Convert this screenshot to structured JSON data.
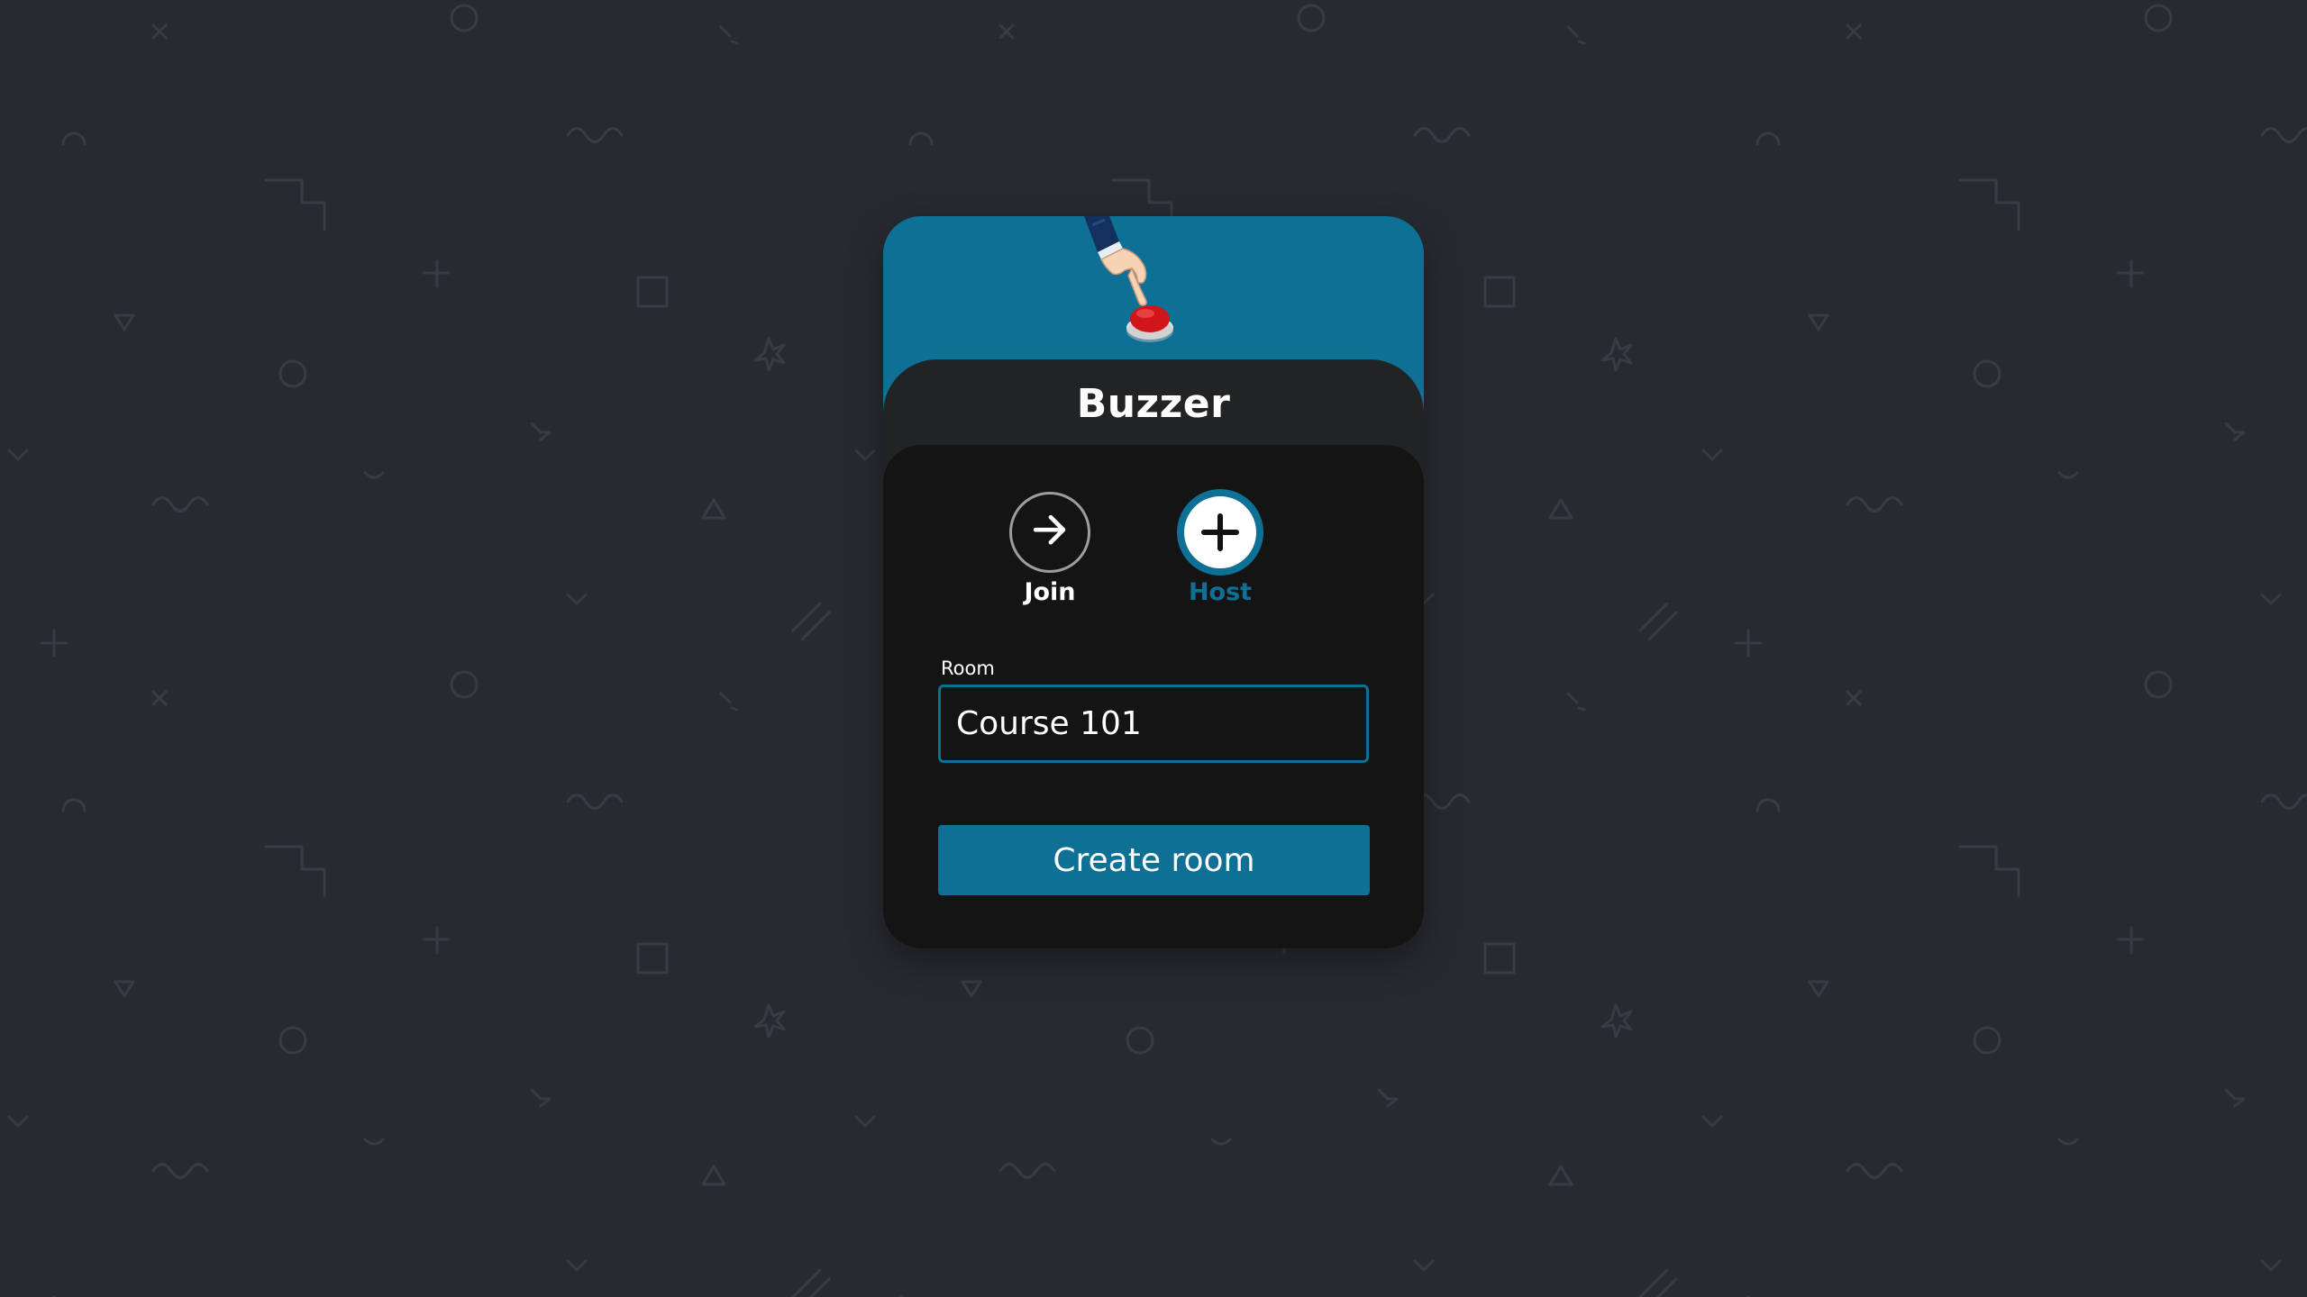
{
  "app": {
    "title": "Buzzer"
  },
  "mode_selector": {
    "options": [
      {
        "label": "Join",
        "icon": "arrow-right-icon",
        "selected": false
      },
      {
        "label": "Host",
        "icon": "plus-icon",
        "selected": true
      }
    ]
  },
  "room_field": {
    "label": "Room",
    "value": "Course 101"
  },
  "actions": {
    "create_label": "Create room"
  },
  "colors": {
    "background": "#272a30",
    "accent": "#0f7096",
    "header_panel": "#222325",
    "content_panel": "#141414",
    "buzzer_red": "#d0161a"
  },
  "illustration": {
    "icon": "hand-pressing-buzzer-icon"
  }
}
